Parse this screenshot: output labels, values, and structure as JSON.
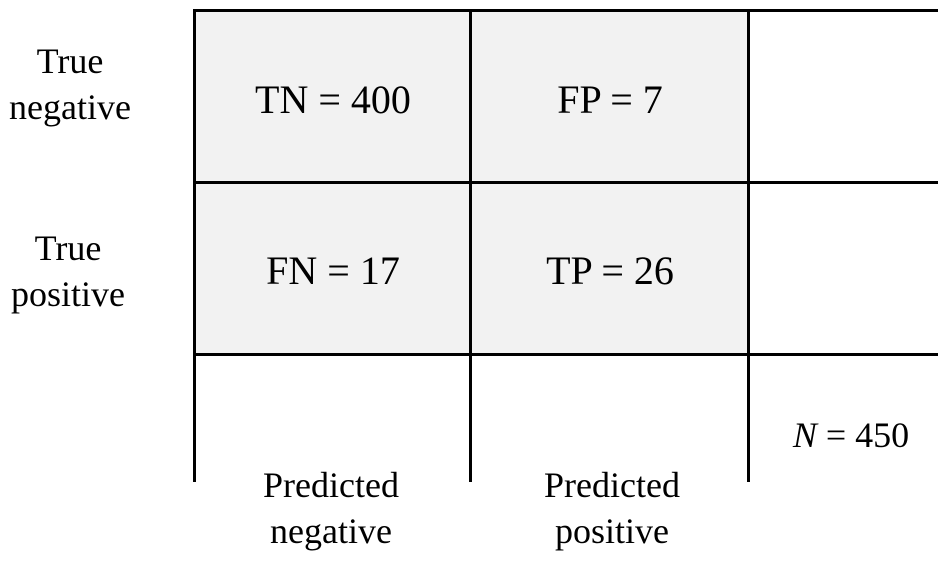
{
  "matrix": {
    "cells": {
      "tn": "TN = 400",
      "fp": "FP = 7",
      "fn": "FN = 17",
      "tp": "TP = 26"
    },
    "row_labels": {
      "negative_line1": "True",
      "negative_line2": "negative",
      "positive_line1": "True",
      "positive_line2": "positive"
    },
    "column_labels": {
      "negative_line1": "Predicted",
      "negative_line2": "negative",
      "positive_line1": "Predicted",
      "positive_line2": "positive"
    },
    "total": {
      "symbol": "N",
      "value": " = 450"
    }
  },
  "colors": {
    "cell_fill": "#f2f2f2",
    "grid_line": "#000000",
    "background": "#ffffff"
  }
}
